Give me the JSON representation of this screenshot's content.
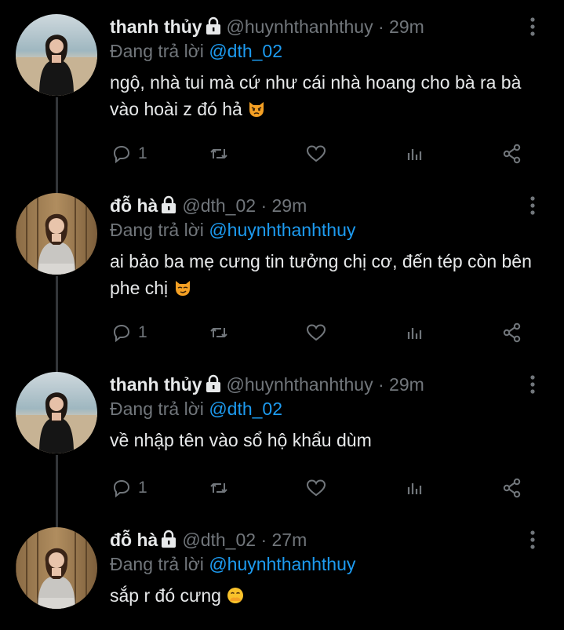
{
  "colors": {
    "background": "#000000",
    "text": "#e7e9ea",
    "secondary": "#71767b",
    "accent": "#1d9bf0",
    "thread_line": "#333639"
  },
  "tweets": [
    {
      "name": "thanh thủy",
      "handle": "@huynhthanhthuy",
      "dot": "·",
      "time": "29m",
      "reply_prefix": "Đang trả lời ",
      "reply_to": "@dth_02",
      "text": "ngộ, nhà tui mà cứ như cái nhà hoang cho bà ra bà vào hoài z đó hả",
      "emoji": "pouting-cat-emoji",
      "reply_count": "1",
      "avatar": "photo of woman in black dress at beach"
    },
    {
      "name": "đỗ hà",
      "handle": "@dth_02",
      "dot": "·",
      "time": "29m",
      "reply_prefix": "Đang trả lời ",
      "reply_to": "@huynhthanhthuy",
      "text": "ai bảo ba mẹ cưng tin tưởng chị cơ, đến tép còn bên phe chị",
      "emoji": "smirking-cat-emoji",
      "reply_count": "1",
      "avatar": "photo of woman in grey outfit sitting by bamboo fence"
    },
    {
      "name": "thanh thủy",
      "handle": "@huynhthanhthuy",
      "dot": "·",
      "time": "29m",
      "reply_prefix": "Đang trả lời ",
      "reply_to": "@dth_02",
      "text": "về nhập tên vào sổ hộ khẩu dùm",
      "emoji": "",
      "reply_count": "1",
      "avatar": "photo of woman in black dress at beach"
    },
    {
      "name": "đỗ hà",
      "handle": "@dth_02",
      "dot": "·",
      "time": "27m",
      "reply_prefix": "Đang trả lời ",
      "reply_to": "@huynhthanhthuy",
      "text": "sắp r đó cưng",
      "emoji": "face-with-hand-over-mouth-emoji",
      "reply_count": "",
      "avatar": "photo of woman in grey outfit sitting by bamboo fence"
    }
  ]
}
